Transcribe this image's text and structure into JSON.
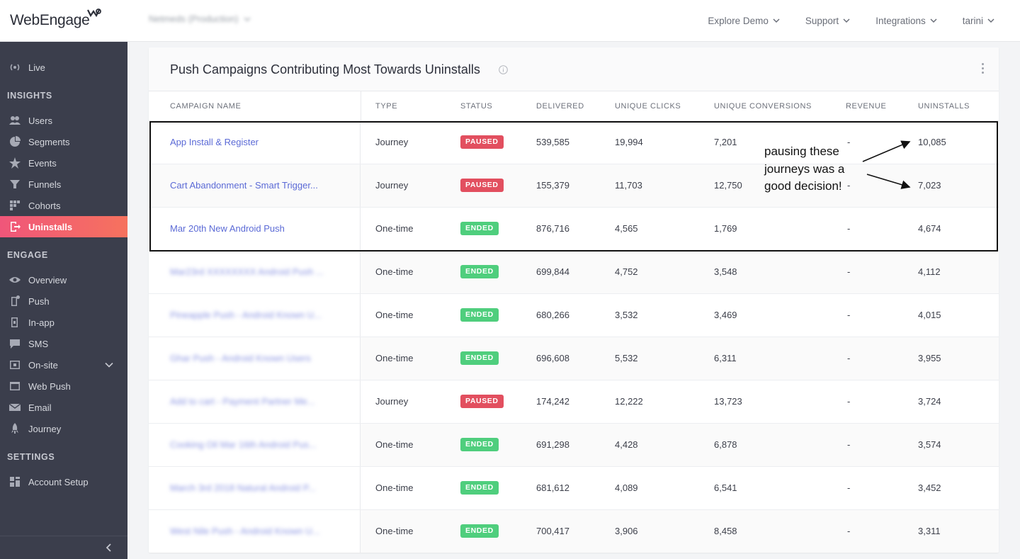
{
  "app": {
    "logo_text": "WebEngage",
    "project_name": "Netmeds (Production)"
  },
  "topnav": [
    {
      "label": "Explore Demo"
    },
    {
      "label": "Support"
    },
    {
      "label": "Integrations"
    },
    {
      "label": "tarini"
    }
  ],
  "sidebar": {
    "live": "Live",
    "insights_heading": "INSIGHTS",
    "insights": [
      "Users",
      "Segments",
      "Events",
      "Funnels",
      "Cohorts",
      "Uninstalls"
    ],
    "engage_heading": "ENGAGE",
    "engage": [
      "Overview",
      "Push",
      "In-app",
      "SMS",
      "On-site",
      "Web Push",
      "Email",
      "Journey"
    ],
    "settings_heading": "SETTINGS",
    "settings": [
      "Account Setup"
    ],
    "active_item": "Uninstalls",
    "active_color": "#f0567a"
  },
  "card": {
    "title": "Push Campaigns Contributing Most Towards Uninstalls",
    "columns": [
      "CAMPAIGN NAME",
      "TYPE",
      "STATUS",
      "DELIVERED",
      "UNIQUE CLICKS",
      "UNIQUE CONVERSIONS",
      "REVENUE",
      "UNINSTALLS"
    ],
    "rows": [
      {
        "name": "App Install & Register",
        "type": "Journey",
        "status": "PAUSED",
        "delivered": "539,585",
        "clicks": "19,994",
        "conversions": "7,201",
        "revenue": "-",
        "uninstalls": "10,085"
      },
      {
        "name": "Cart Abandonment - Smart Trigger...",
        "type": "Journey",
        "status": "PAUSED",
        "delivered": "155,379",
        "clicks": "11,703",
        "conversions": "12,750",
        "revenue": "-",
        "uninstalls": "7,023"
      },
      {
        "name": "Mar 20th New Android Push",
        "type": "One-time",
        "status": "ENDED",
        "delivered": "876,716",
        "clicks": "4,565",
        "conversions": "1,769",
        "revenue": "-",
        "uninstalls": "4,674"
      },
      {
        "name": "Mar23rd XXXXXXXX Android Push ...",
        "type": "One-time",
        "status": "ENDED",
        "delivered": "699,844",
        "clicks": "4,752",
        "conversions": "3,548",
        "revenue": "-",
        "uninstalls": "4,112"
      },
      {
        "name": "Pineapple Push - Android Known U...",
        "type": "One-time",
        "status": "ENDED",
        "delivered": "680,266",
        "clicks": "3,532",
        "conversions": "3,469",
        "revenue": "-",
        "uninstalls": "4,015"
      },
      {
        "name": "Ghar Push - Android Known Users",
        "type": "One-time",
        "status": "ENDED",
        "delivered": "696,608",
        "clicks": "5,532",
        "conversions": "6,311",
        "revenue": "-",
        "uninstalls": "3,955"
      },
      {
        "name": "Add to cart - Payment Partner Me...",
        "type": "Journey",
        "status": "PAUSED",
        "delivered": "174,242",
        "clicks": "12,222",
        "conversions": "13,723",
        "revenue": "-",
        "uninstalls": "3,724"
      },
      {
        "name": "Cooking Oil Mar 16th Android Pus...",
        "type": "One-time",
        "status": "ENDED",
        "delivered": "691,298",
        "clicks": "4,428",
        "conversions": "6,878",
        "revenue": "-",
        "uninstalls": "3,574"
      },
      {
        "name": "March 3rd 2018 Natural Android P...",
        "type": "One-time",
        "status": "ENDED",
        "delivered": "681,612",
        "clicks": "4,089",
        "conversions": "6,541",
        "revenue": "-",
        "uninstalls": "3,452"
      },
      {
        "name": "West Nile Push - Android Known U...",
        "type": "One-time",
        "status": "ENDED",
        "delivered": "700,417",
        "clicks": "3,906",
        "conversions": "8,458",
        "revenue": "-",
        "uninstalls": "3,311"
      }
    ]
  },
  "annotation": {
    "line1": "pausing these",
    "line2": "journeys was a",
    "line3": "good decision!"
  },
  "colors": {
    "paused": "#e24f5f",
    "ended": "#4fce7d",
    "link": "#5b6ad6"
  }
}
